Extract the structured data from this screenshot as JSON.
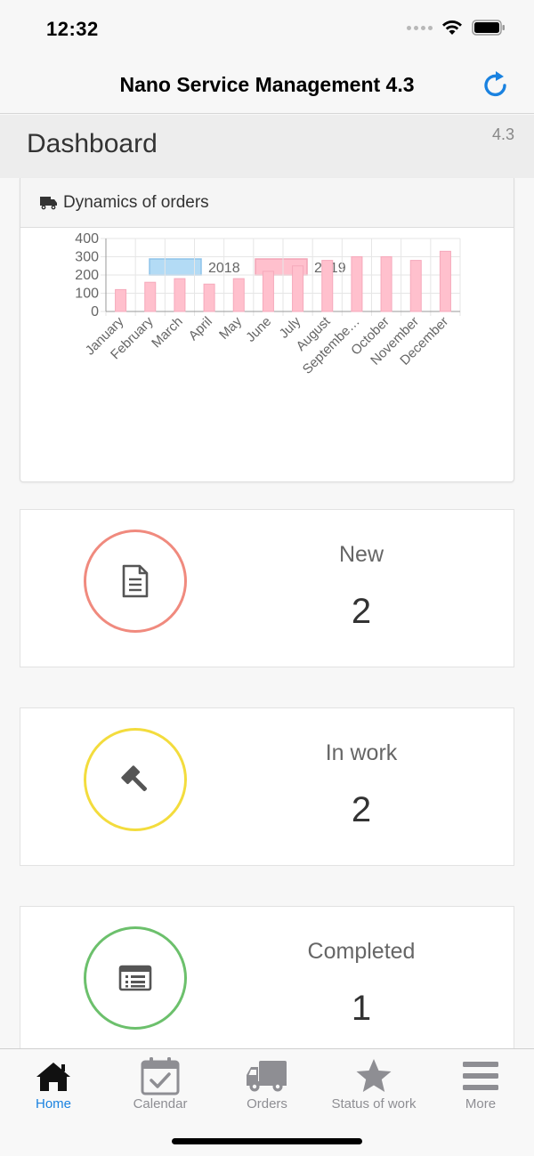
{
  "status_bar": {
    "time": "12:32"
  },
  "nav": {
    "title": "Nano Service Management 4.3",
    "refresh_icon": "refresh-icon"
  },
  "header": {
    "title": "Dashboard",
    "version": "4.3"
  },
  "chart_card": {
    "title": "Dynamics of orders",
    "icon": "truck-icon"
  },
  "chart_data": {
    "type": "bar",
    "categories": [
      "January",
      "February",
      "March",
      "April",
      "May",
      "June",
      "July",
      "August",
      "Septembe…",
      "October",
      "November",
      "December"
    ],
    "series": [
      {
        "name": "2018",
        "values": [
          0,
          0,
          0,
          0,
          0,
          0,
          0,
          0,
          0,
          0,
          0,
          0
        ],
        "color": "#b3dbf5"
      },
      {
        "name": "2019",
        "values": [
          120,
          160,
          180,
          150,
          180,
          220,
          250,
          280,
          300,
          300,
          280,
          330
        ],
        "color": "#ffc0cd"
      }
    ],
    "yticks": [
      "0",
      "100",
      "200",
      "300",
      "400"
    ],
    "ylim": [
      0,
      400
    ],
    "legend": "top",
    "grid": true
  },
  "stats": [
    {
      "label": "New",
      "value": "2",
      "icon": "document-icon",
      "color": "#f08a7e"
    },
    {
      "label": "In work",
      "value": "2",
      "icon": "gavel-icon",
      "color": "#f3dc3d"
    },
    {
      "label": "Completed",
      "value": "1",
      "icon": "list-icon",
      "color": "#6cc06c"
    }
  ],
  "tabs": [
    {
      "label": "Home",
      "icon": "home-icon",
      "active": true
    },
    {
      "label": "Calendar",
      "icon": "calendar-icon"
    },
    {
      "label": "Orders",
      "icon": "truck-icon"
    },
    {
      "label": "Status of work",
      "icon": "star-icon"
    },
    {
      "label": "More",
      "icon": "menu-icon"
    }
  ],
  "colors": {
    "accent": "#1a82e0",
    "inactive": "#8e8e93"
  }
}
